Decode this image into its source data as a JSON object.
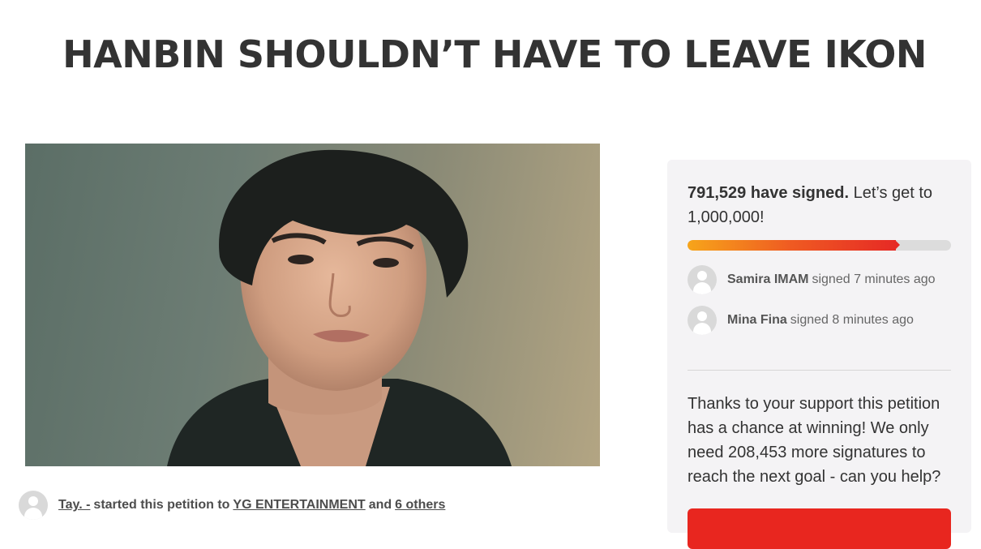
{
  "petition": {
    "title": "HANBIN SHOULDN’T HAVE TO LEAVE IKON"
  },
  "starter": {
    "name": "Tay. -",
    "text_started": "started this petition to",
    "target": "YG ENTERTAINMENT",
    "text_and": "and",
    "others": "6 others"
  },
  "signatures": {
    "count_label": "791,529 have signed.",
    "goal_text": "Let’s get to 1,000,000!",
    "progress": 0.79,
    "recent": [
      {
        "name": "Samira IMAM",
        "action": "signed 7 minutes ago"
      },
      {
        "name": "Mina Fina",
        "action": "signed 8 minutes ago"
      }
    ],
    "support_text": "Thanks to your support this petition has a chance at winning! We only need 208,453 more signatures to reach the next goal - can you help?"
  },
  "colors": {
    "accent": "#e8261f",
    "progress_start": "#f7a51a",
    "progress_end": "#e62a25",
    "panel_bg": "#f4f3f5"
  }
}
